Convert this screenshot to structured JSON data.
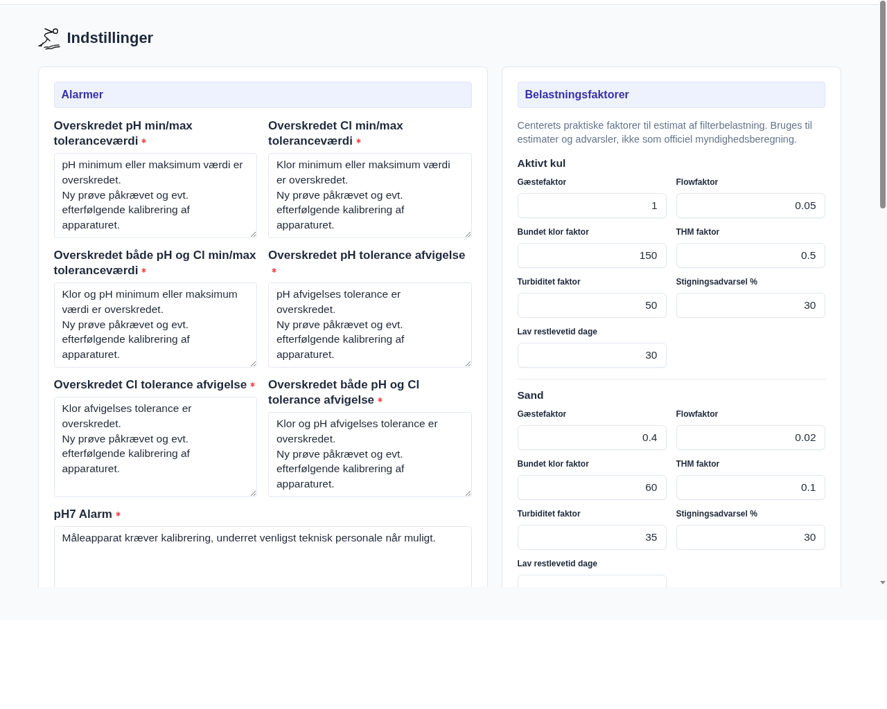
{
  "header": {
    "title": "Indstillinger"
  },
  "alarms": {
    "title": "Alarmer",
    "fields": [
      {
        "kind": "half",
        "label": "Overskredet pH min/max toleranceværdi",
        "required": true,
        "value": "pH minimum eller maksimum værdi er overskredet.\nNy prøve påkrævet og evt. efterfølgende kalibrering af apparaturet."
      },
      {
        "kind": "half",
        "label": "Overskredet Cl min/max toleranceværdi",
        "required": true,
        "value": "Klor minimum eller maksimum værdi er overskredet.\nNy prøve påkrævet og evt. efterfølgende kalibrering af apparaturet."
      },
      {
        "kind": "half",
        "label": "Overskredet både pH og Cl min/max toleranceværdi",
        "required": true,
        "value": "Klor og pH minimum eller maksimum værdi er overskredet.\nNy prøve påkrævet og evt. efterfølgende kalibrering af apparaturet."
      },
      {
        "kind": "half",
        "label": "Overskredet pH tolerance afvigelse",
        "required": true,
        "value": "pH afvigelses tolerance er overskredet.\nNy prøve påkrævet og evt. efterfølgende kalibrering af apparaturet."
      },
      {
        "kind": "half",
        "label": "Overskredet Cl tolerance afvigelse",
        "required": true,
        "value": "Klor afvigelses tolerance er overskredet.\nNy prøve påkrævet og evt. efterfølgende kalibrering af apparaturet."
      },
      {
        "kind": "half",
        "label": "Overskredet både pH og Cl tolerance afvigelse",
        "required": true,
        "value": "Klor og pH afvigelses tolerance er overskredet.\nNy prøve påkrævet og evt. efterfølgende kalibrering af apparaturet."
      },
      {
        "kind": "full",
        "label": "pH7 Alarm",
        "required": true,
        "value": "Måleapparat kræver kalibrering, underret venligst teknisk personale når muligt."
      }
    ]
  },
  "load_factors": {
    "title": "Belastningsfaktorer",
    "description": "Centerets praktiske faktorer til estimat af filterbelastning. Bruges til estimater og advarsler, ikke som officiel myndighedsberegning.",
    "groups": [
      {
        "title": "Aktivt kul",
        "fields": [
          {
            "label": "Gæstefaktor",
            "value": "1"
          },
          {
            "label": "Flowfaktor",
            "value": "0.05"
          },
          {
            "label": "Bundet klor faktor",
            "value": "150"
          },
          {
            "label": "THM faktor",
            "value": "0.5"
          },
          {
            "label": "Turbiditet faktor",
            "value": "50"
          },
          {
            "label": "Stigningsadvarsel %",
            "value": "30"
          },
          {
            "label": "Lav restlevetid dage",
            "value": "30"
          }
        ]
      },
      {
        "title": "Sand",
        "fields": [
          {
            "label": "Gæstefaktor",
            "value": "0.4"
          },
          {
            "label": "Flowfaktor",
            "value": "0.02"
          },
          {
            "label": "Bundet klor faktor",
            "value": "60"
          },
          {
            "label": "THM faktor",
            "value": "0.1"
          },
          {
            "label": "Turbiditet faktor",
            "value": "35"
          },
          {
            "label": "Stigningsadvarsel %",
            "value": "30"
          },
          {
            "label": "Lav restlevetid dage"
          }
        ]
      }
    ]
  }
}
